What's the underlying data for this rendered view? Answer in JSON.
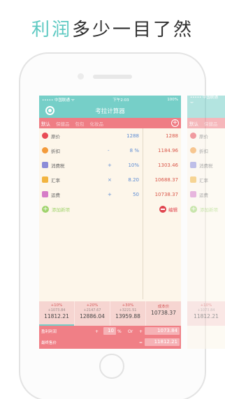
{
  "headline": {
    "accent": "利润",
    "rest": "多少一目了然"
  },
  "status_bar": {
    "carrier": "••••• 中国联通 ᯤ",
    "time": "下午2:03",
    "battery": "100%"
  },
  "app": {
    "title": "考拉计算器"
  },
  "tabs": [
    {
      "label": "默认",
      "active": true
    },
    {
      "label": "保健品",
      "active": false
    },
    {
      "label": "包包",
      "active": false
    },
    {
      "label": "化妆品",
      "active": false
    }
  ],
  "rows": [
    {
      "label": "原价",
      "op": "",
      "value": "1288",
      "result": "1288",
      "icon": "price-icon",
      "color": "#e84b55"
    },
    {
      "label": "折扣",
      "op": "-",
      "value": "8 %",
      "result": "1184.96",
      "icon": "discount-icon",
      "color": "#f39a3a"
    },
    {
      "label": "消费税",
      "op": "+",
      "value": "10%",
      "result": "1303.46",
      "icon": "tax-icon",
      "color": "#8c8cd8"
    },
    {
      "label": "汇率",
      "op": "×",
      "value": "8.20",
      "result": "10688.37",
      "icon": "exchange-icon",
      "color": "#f2b440"
    },
    {
      "label": "运费",
      "op": "+",
      "value": "50",
      "result": "10738.37",
      "icon": "shipping-icon",
      "color": "#d67cc7"
    }
  ],
  "add_new": "添加新项",
  "edit": "编辑",
  "percentages": [
    {
      "top": "+10%",
      "mid": "+1073.84",
      "bottom": "11812.21",
      "selected": true
    },
    {
      "top": "+20%",
      "mid": "+2147.67",
      "bottom": "12886.04",
      "selected": false
    },
    {
      "top": "+30%",
      "mid": "+3221.51",
      "bottom": "13959.88",
      "selected": false
    },
    {
      "top": "成本价",
      "mid": "",
      "bottom": "10738.37",
      "selected": false
    }
  ],
  "bottom": {
    "profit_label": "盈利利润",
    "plus": "+",
    "pct_value": "10",
    "pct_sign": "%",
    "or": "Or",
    "op_plus": "+",
    "profit_value": "1073.84",
    "final_label": "最终售价",
    "eq": "=",
    "final_value": "11812.21"
  },
  "ghost": {
    "tabs": [
      "默认",
      "保健品"
    ],
    "rows": [
      "原价",
      "折扣",
      "消费税",
      "汇率",
      "运费"
    ],
    "add": "添加新项",
    "pct_top": "+10%",
    "pct_mid": "+1073.84",
    "pct_bot": "11812.21"
  }
}
